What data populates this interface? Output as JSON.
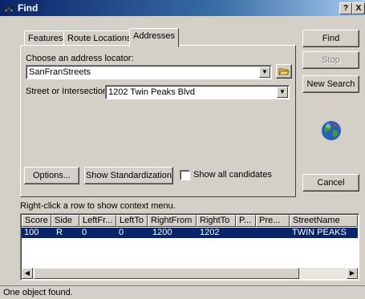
{
  "window": {
    "title": "Find",
    "help": "?",
    "close": "X"
  },
  "tabs": [
    {
      "label": "Features"
    },
    {
      "label": "Route Locations"
    },
    {
      "label": "Addresses"
    }
  ],
  "panel": {
    "locator_label": "Choose an address locator:",
    "locator_value": "SanFranStreets",
    "street_label": "Street or Intersection:",
    "street_value": "1202 Twin Peaks Blvd",
    "options_button": "Options...",
    "standardization_button": "Show Standardization",
    "show_all_label": "Show all candidates"
  },
  "buttons": {
    "find": "Find",
    "stop": "Stop",
    "new_search": "New Search",
    "cancel": "Cancel"
  },
  "results": {
    "hint": "Right-click a row to show context menu.",
    "columns": [
      "Score",
      "Side",
      "LeftFr...",
      "LeftTo",
      "RightFrom",
      "RightTo",
      "P...",
      "Pre...",
      "StreetName"
    ],
    "rows": [
      {
        "score": "100",
        "side": "R",
        "leftfrom": "0",
        "leftto": "0",
        "rightfrom": "1200",
        "rightto": "1202",
        "p": "",
        "pre": "",
        "streetname": "TWIN PEAKS"
      }
    ]
  },
  "status": "One object found."
}
